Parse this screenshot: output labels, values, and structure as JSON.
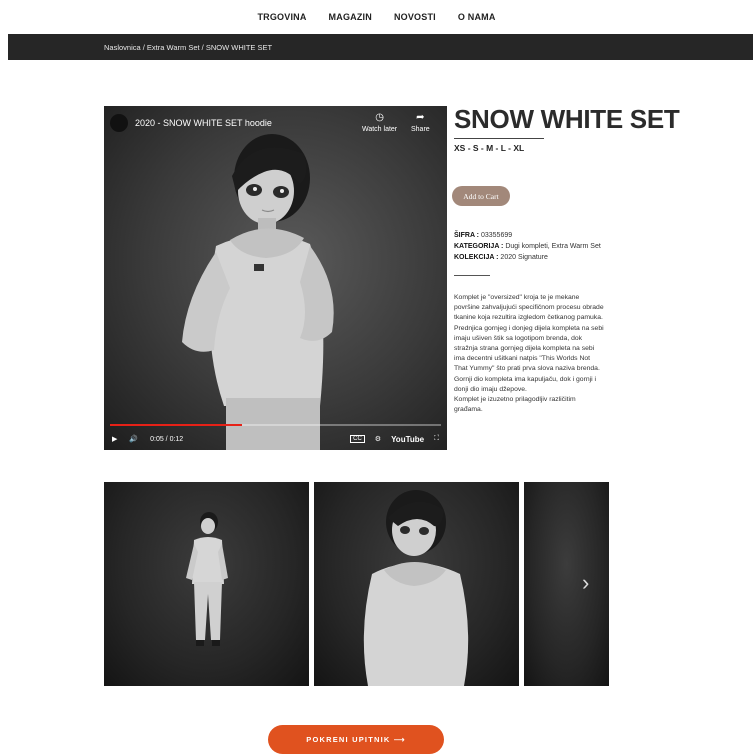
{
  "nav": {
    "items": [
      "TRGOVINA",
      "MAGAZIN",
      "NOVOSTI",
      "O NAMA"
    ]
  },
  "breadcrumb": {
    "text": "Naslovnica / Extra Warm Set / SNOW WHITE SET"
  },
  "video": {
    "title": "2020 - SNOW WHITE SET hoodie",
    "watch_later_label": "Watch later",
    "share_label": "Share",
    "time": "0:05 / 0:12",
    "progress_fraction": 0.4,
    "cc_label": "CC",
    "youtube_label": "YouTube",
    "icons": [
      "clock-icon",
      "share-icon",
      "play-icon",
      "volume-icon",
      "cc-icon",
      "settings-icon",
      "fullscreen-icon"
    ]
  },
  "product": {
    "title": "SNOW WHITE SET",
    "sizes": "XS - S - M - L - XL",
    "add_to_cart": "Add to Cart",
    "sku_label": "ŠIFRA :",
    "sku_value": "03355699",
    "category_label": "KATEGORIJA :",
    "category_value": "Dugi kompleti, Extra Warm Set",
    "collection_label": "KOLEKCIJA :",
    "collection_value": "2020 Signature",
    "description": [
      "Komplet je \"oversized\" kroja te je mekane površine zahvaljujući specifičnom procesu obrade tkanine koja rezultira izgledom četkanog pamuka.",
      "Prednjica gornjeg i donjeg dijela kompleta na sebi imaju ušiven štik sa logotipom brenda, dok stražnja strana gornjeg dijela kompleta na sebi ima decentni ušitkani natpis \"This Worlds Not That Yummy\" što prati prva slova naziva brenda.",
      "Gornji dio kompleta ima kapuljaču, dok i gornji i donji dio imaju džepove.",
      "Komplet je izuzetno prilagodljiv različitim građama."
    ]
  },
  "gallery": {
    "next_icon": "chevron-right-icon"
  },
  "cta": {
    "label": "POKRENI UPITNIK  ⟶"
  },
  "colors": {
    "accent": "#e0521f",
    "cart_button": "#a2887a",
    "breadcrumb_bg": "#262626",
    "progress": "#e62117"
  }
}
